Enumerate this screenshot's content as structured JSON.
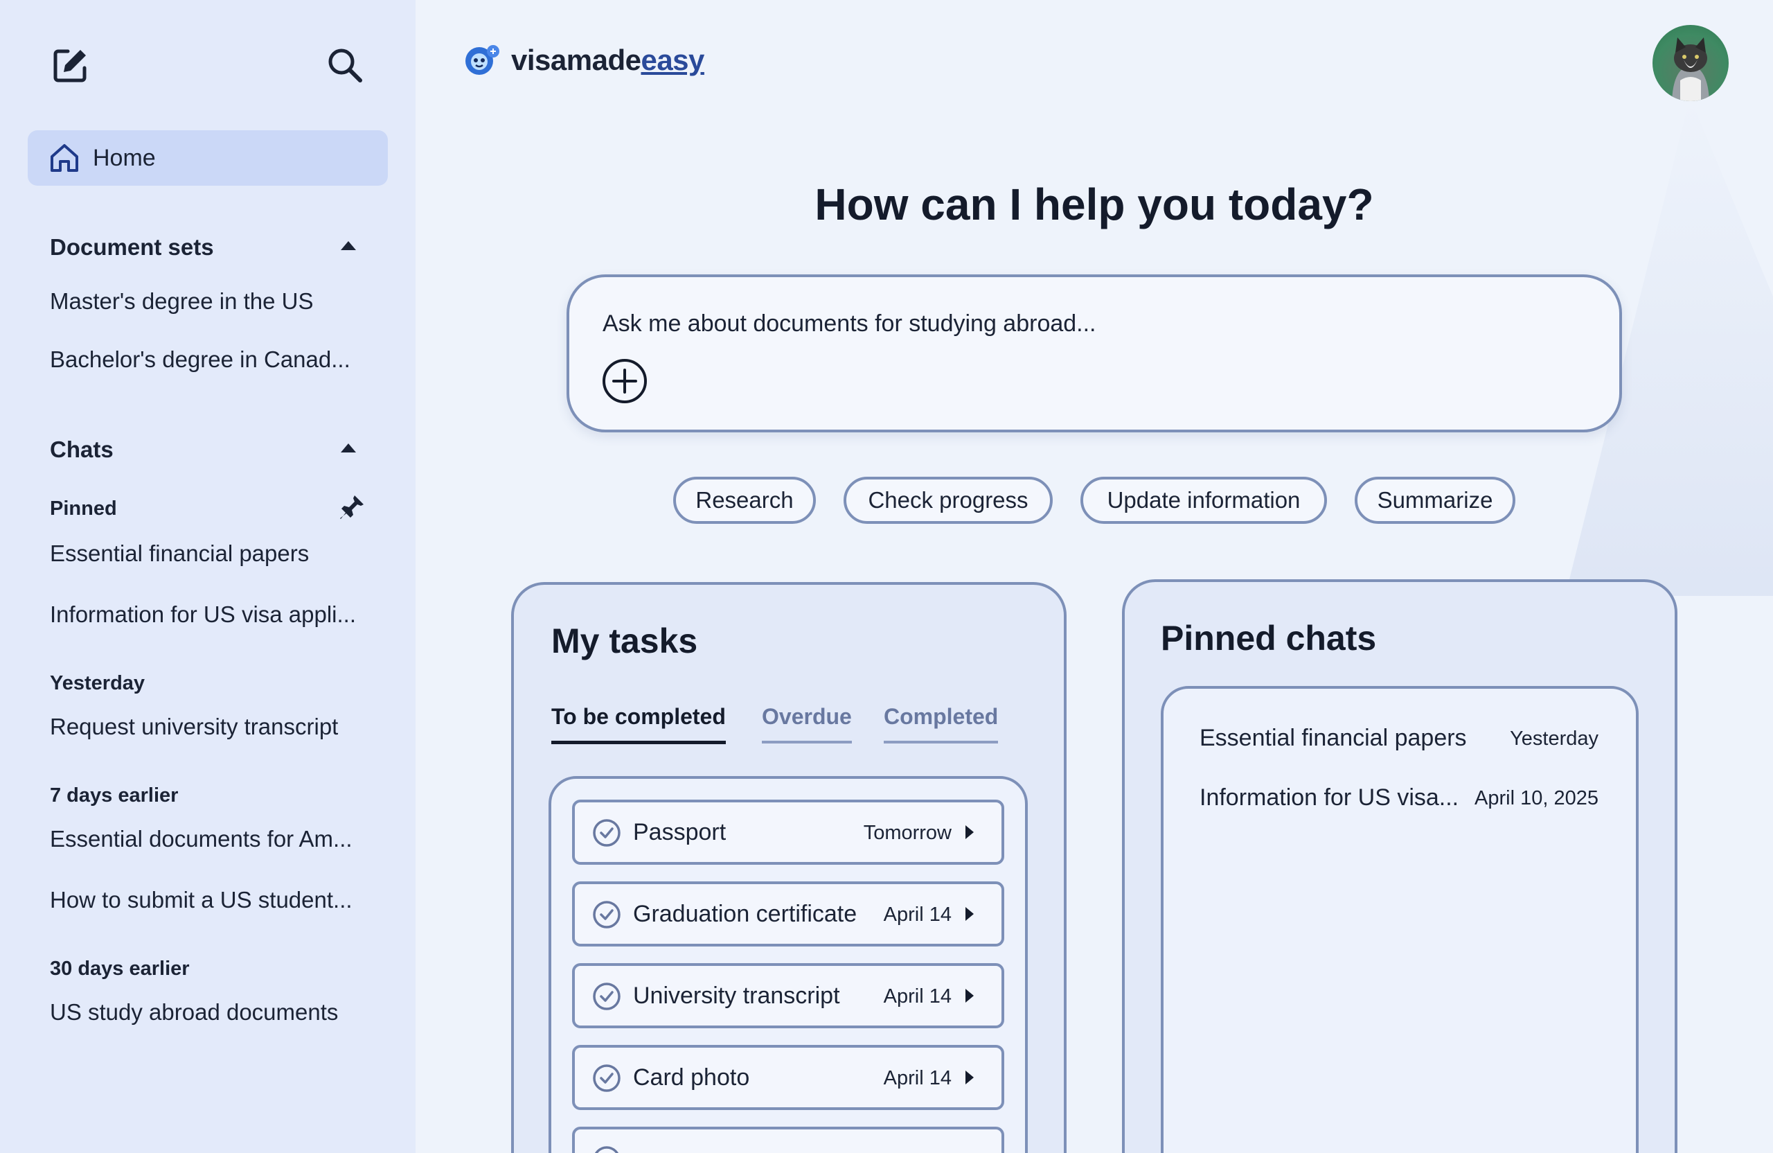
{
  "sidebar": {
    "home_label": "Home",
    "document_sets": {
      "heading": "Document sets",
      "items": [
        "Master's degree in the US",
        "Bachelor's degree in Canad..."
      ]
    },
    "chats": {
      "heading": "Chats",
      "pinned_label": "Pinned",
      "pinned": [
        "Essential financial papers",
        "Information for US visa appli..."
      ],
      "yesterday_label": "Yesterday",
      "yesterday": [
        "Request university transcript"
      ],
      "week_label": "7 days earlier",
      "week": [
        "Essential documents for Am...",
        "How to submit a US student..."
      ],
      "month_label": "30 days earlier",
      "month": [
        "US study abroad documents"
      ]
    }
  },
  "header": {
    "brand_part1": "visamade",
    "brand_part2": "easy"
  },
  "main": {
    "headline": "How can I help you today?",
    "ask_placeholder": "Ask me about documents for studying abroad...",
    "chips": [
      "Research",
      "Check progress",
      "Update information",
      "Summarize"
    ]
  },
  "tasks": {
    "title": "My tasks",
    "tabs": [
      "To be completed",
      "Overdue",
      "Completed"
    ],
    "active_tab": "To be completed",
    "items": [
      {
        "name": "Passport",
        "due": "Tomorrow"
      },
      {
        "name": "Graduation certificate",
        "due": "April 14"
      },
      {
        "name": "University transcript",
        "due": "April 14"
      },
      {
        "name": "Card photo",
        "due": "April 14"
      }
    ]
  },
  "pinned_chats": {
    "title": "Pinned chats",
    "items": [
      {
        "title": "Essential financial papers",
        "date": "Yesterday"
      },
      {
        "title": "Information for US visa...",
        "date": "April 10, 2025"
      }
    ]
  },
  "colors": {
    "sidebar_bg": "#e3eafa",
    "main_bg": "#eef3fb",
    "home_highlight": "#cbd8f7",
    "border": "#7d90b8",
    "brand_accent": "#2a4a9a",
    "text": "#1b2335"
  }
}
